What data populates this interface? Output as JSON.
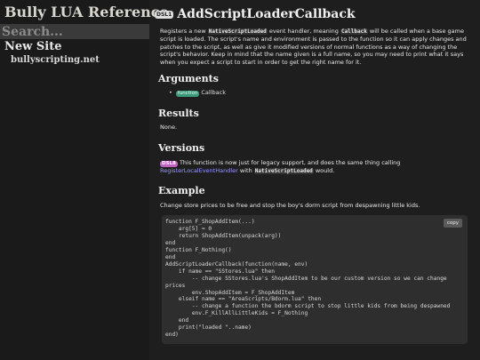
{
  "sidebar": {
    "site_title": "Bully LUA Reference",
    "search_placeholder": "Search...",
    "new_site_heading": "New Site",
    "new_site_link": "bullyscripting.net"
  },
  "main": {
    "title_badge": "DSL1",
    "title": "AddScriptLoaderCallback",
    "description": {
      "p1": "Registers a new ",
      "code1": "NativeScriptLoaded",
      "p2": " event handler, meaning ",
      "code2": "Callback",
      "p3": " will be called when a base game script is loaded. The script's name and environment is passed to the function so it can apply changes and patches to the script, as well as give it modified versions of normal functions as a way of changing the script's behavior. Keep in mind that the name given is a full name, so you may need to print what it says when you expect a script to start in order to get the right name for it."
    },
    "arguments_heading": "Arguments",
    "arguments": [
      {
        "type": "function",
        "name": "Callback"
      }
    ],
    "results_heading": "Results",
    "results_text": "None.",
    "versions_heading": "Versions",
    "versions": {
      "badge": "DSL8",
      "t1": "This function is now just for legacy support, and does the same thing calling ",
      "link": "RegisterLocalEventHandler",
      "t2": " with ",
      "code": "NativeScriptLoaded",
      "t3": " would."
    },
    "example_heading": "Example",
    "example_text": "Change store prices to be free and stop the boy's dorm script from despawning little kids.",
    "copy_label": "copy",
    "code": "function F_ShopAddItem(...)\n    arg[5] = 0\n    return ShopAddItem(unpack(arg))\nend\nfunction F_Nothing()\nend\nAddScriptLoaderCallback(function(name, env)\n    if name == \"SStores.lua\" then\n        -- change SStores.lua's ShopAddItem to be our custom version so we can change prices\n        env.ShopAddItem = F_ShopAddItem\n    elseif name == \"AreaScripts/Bdorm.lua\" then\n        -- change a function the bdorm script to stop little kids from being despawned\n        env.F_KillAllLittleKids = F_Nothing\n    end\n    print(\"loaded \"..name)\nend)"
  }
}
